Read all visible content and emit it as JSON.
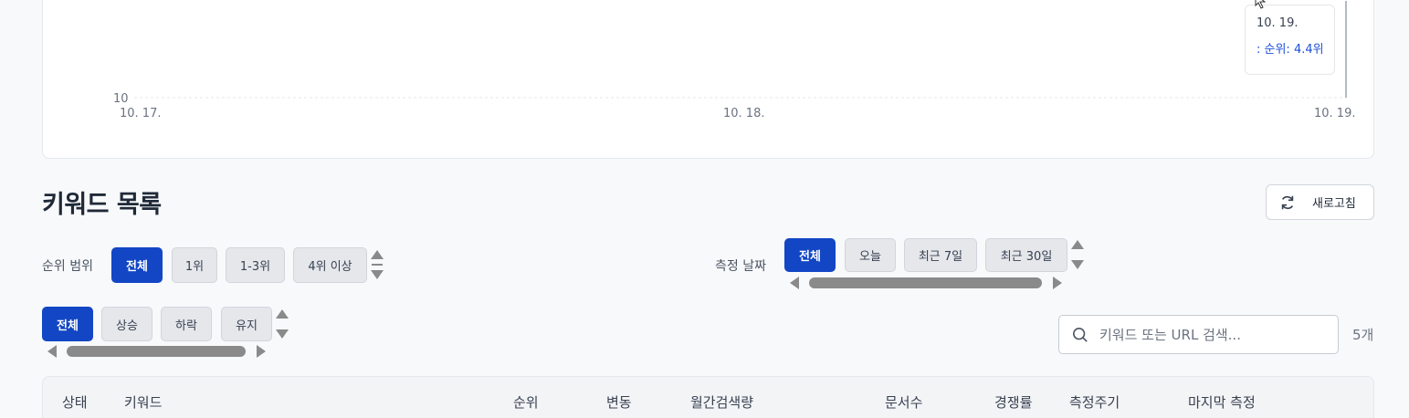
{
  "chart_data": {
    "type": "line",
    "x": [
      "10. 17.",
      "10. 18.",
      "10. 19."
    ],
    "y_ticks": [
      10
    ],
    "series": [],
    "tooltip": {
      "date": "10. 19.",
      "value_text": ": 순위: 4.4위"
    }
  },
  "keywords": {
    "title": "키워드 목록",
    "refresh_label": "새로고침",
    "rank_filter": {
      "label": "순위 범위",
      "options": [
        "전체",
        "1위",
        "1-3위",
        "4위 이상"
      ],
      "selected": "전체"
    },
    "date_filter": {
      "label": "측정 날짜",
      "options": [
        "전체",
        "오늘",
        "최근 7일",
        "최근 30일"
      ],
      "selected": "전체"
    },
    "trend_filter": {
      "options": [
        "전체",
        "상승",
        "하락",
        "유지"
      ],
      "selected": "전체"
    },
    "search": {
      "placeholder": "키워드 또는 URL 검색..."
    },
    "count_label": "5개",
    "columns": [
      "상태",
      "키워드",
      "순위",
      "변동",
      "월간검색량",
      "문서수",
      "경쟁률",
      "측정주기",
      "마지막 측정"
    ]
  },
  "colors": {
    "accent": "#1246c4",
    "tooltip_value": "#1d4ed8"
  },
  "icons": {
    "refresh": "refresh-icon",
    "search": "search-icon",
    "cursor": "cursor-icon"
  }
}
